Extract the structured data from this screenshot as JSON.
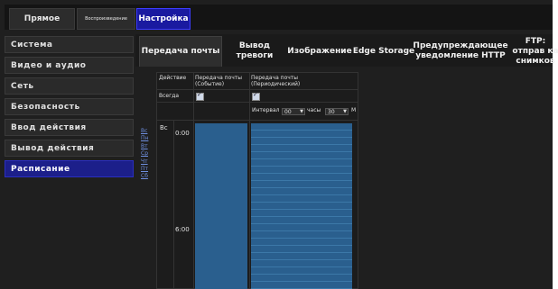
{
  "top_tabs": {
    "live": "Прямое",
    "playback": "Воспроизведение",
    "setup": "Настройка"
  },
  "menu": {
    "items": [
      {
        "label": "Система"
      },
      {
        "label": "Видео и аудио"
      },
      {
        "label": "Сеть"
      },
      {
        "label": "Безопасность"
      },
      {
        "label": "Ввод действия"
      },
      {
        "label": "Вывод действия"
      },
      {
        "label": "Расписание"
      }
    ],
    "active_index": 6
  },
  "subtabs": [
    {
      "label": "Передача почты"
    },
    {
      "label": "Вывод тревоги"
    },
    {
      "label": "Изображение"
    },
    {
      "label": "Edge Storage"
    },
    {
      "label": "Предупреждающее уведомление HTTP"
    },
    {
      "label": "FTP: отправ ка снимков"
    }
  ],
  "schedule": {
    "action_header": "Действие",
    "col_event": "Передача почты (Событие)",
    "col_periodic": "Передача почты (Периодический)",
    "always_label": "Всегда",
    "always_event_checked": true,
    "always_periodic_checked": true,
    "interval_label": "Интервал",
    "interval_hours_value": "00",
    "hours_label": "часы",
    "interval_minutes_value": "30",
    "minutes_suffix": "М",
    "day_col_label": "Вс",
    "time_0": "0:00",
    "time_6": "6:00",
    "days": [
      "Вс",
      "Пн",
      "Вт",
      "Ср",
      "Чт",
      "Пт",
      "Сб"
    ],
    "colors": {
      "bar": "#2a5f8e",
      "active_tab": "#1a1aa0"
    }
  }
}
